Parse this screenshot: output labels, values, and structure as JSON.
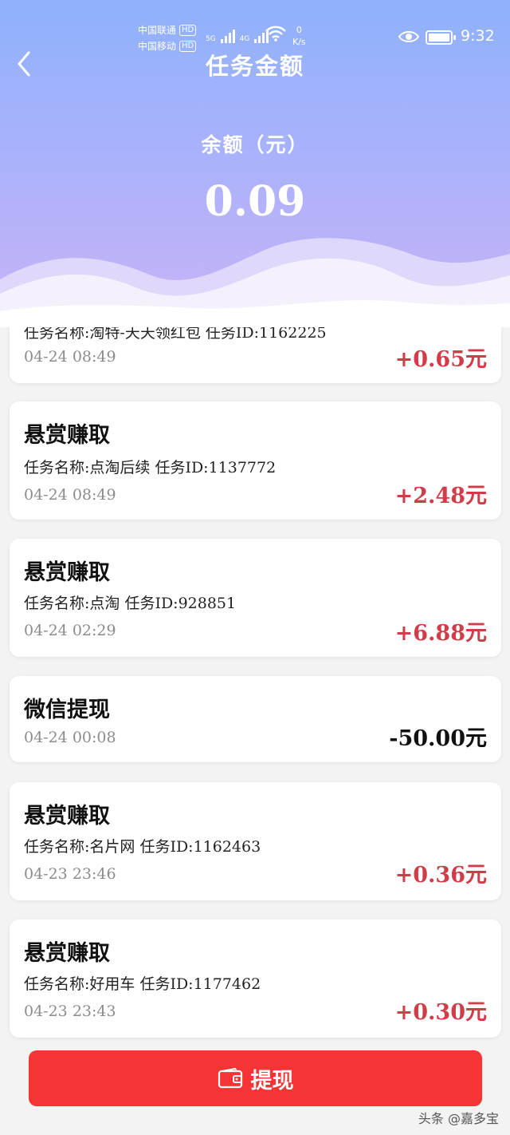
{
  "status_bar": {
    "carrier_1": "中国联通",
    "carrier_2": "中国移动",
    "hd_badge": "HD",
    "net_1": "5G",
    "net_2": "4G",
    "speed_value": "0",
    "speed_unit": "K/s",
    "time": "9:32"
  },
  "header": {
    "title": "任务金额",
    "balance_label": "余额（元）",
    "balance_value": "0.09"
  },
  "records": [
    {
      "type": "",
      "detail": "任务名称:淘特-天天领红包  任务ID:1162225",
      "time": "04-24 08:49",
      "amount": "+0.65元",
      "sign": "pos"
    },
    {
      "type": "悬赏赚取",
      "detail": "任务名称:点淘后续  任务ID:1137772",
      "time": "04-24 08:49",
      "amount": "+2.48元",
      "sign": "pos"
    },
    {
      "type": "悬赏赚取",
      "detail": "任务名称:点淘  任务ID:928851",
      "time": "04-24 02:29",
      "amount": "+6.88元",
      "sign": "pos"
    },
    {
      "type": "微信提现",
      "detail": "",
      "time": "04-24 00:08",
      "amount": "-50.00元",
      "sign": "neg"
    },
    {
      "type": "悬赏赚取",
      "detail": "任务名称:名片网  任务ID:1162463",
      "time": "04-23 23:46",
      "amount": "+0.36元",
      "sign": "pos"
    },
    {
      "type": "悬赏赚取",
      "detail": "任务名称:好用车  任务ID:1177462",
      "time": "04-23 23:43",
      "amount": "+0.30元",
      "sign": "pos"
    }
  ],
  "withdraw_button": {
    "label": "提现",
    "icon": "wallet-icon"
  },
  "watermark": "头条 @嘉多宝",
  "colors": {
    "positive": "#d03c47",
    "button": "#f73435",
    "header_top": "#8fb1fb",
    "header_bottom": "#c9b3f7"
  }
}
